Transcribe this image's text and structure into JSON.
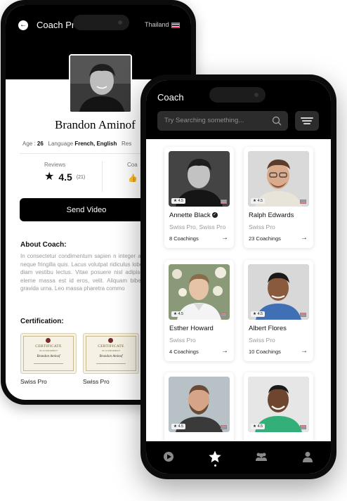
{
  "back": {
    "header_title": "Coach Pro",
    "country": "Thailand",
    "name": "Brandon Aminof",
    "age_label": "Age :",
    "age_value": "26",
    "language_label": "Language",
    "language_value": "French, English",
    "res_label": "Res",
    "reviews_label": "Reviews",
    "rating": "4.5",
    "rating_count": "(21)",
    "coach_label": "Coa",
    "send_button": "Send Video",
    "about_title": "About Coach:",
    "about_text": "In consectetur condimentum sapien n integer amet neque fringilla quis. Lacus volutpat ridiculus lobortis diam vestibu lectus. Vitae posuere nisl adipiscing eleme massa est id eros, velit. Aliquam bibendu gravida urna. Leo massa pharetra commo",
    "cert_title": "Certification:",
    "certs": [
      {
        "title": "CERTIFICATE",
        "subtitle": "OF ACHIEVEMENT",
        "signature": "Brandon Aminof",
        "label": "Swiss Pro"
      },
      {
        "title": "CERTIFICATE",
        "subtitle": "OF ACHIEVEMENT",
        "signature": "Brandon Aminof",
        "label": "Swiss Pro"
      }
    ]
  },
  "front": {
    "header_title": "Coach",
    "search_placeholder": "Try Searching something...",
    "coaches": [
      {
        "name": "Annette Black",
        "verified": true,
        "sub": "Swiss Pro,  Swiss Pro",
        "count": "8 Coachings",
        "rating": "4.5"
      },
      {
        "name": "Ralph Edwards",
        "verified": false,
        "sub": "Swiss Pro",
        "count": "23 Coachings",
        "rating": "4.5"
      },
      {
        "name": "Esther Howard",
        "verified": false,
        "sub": "Swiss Pro",
        "count": "4 Coachings",
        "rating": "4.5"
      },
      {
        "name": "Albert Flores",
        "verified": false,
        "sub": "Swiss Pro",
        "count": "10 Coachings",
        "rating": "4.5"
      },
      {
        "name": "",
        "verified": false,
        "sub": "",
        "count": "",
        "rating": "4.5"
      },
      {
        "name": "",
        "verified": false,
        "sub": "",
        "count": "",
        "rating": "4.5"
      }
    ],
    "tabs": [
      "play-icon",
      "star-icon",
      "group-icon",
      "profile-icon"
    ],
    "active_tab": "star-icon"
  },
  "colors": {
    "header_bg": "#000000",
    "search_bg": "#2c2c2c",
    "muted_text": "#9a9a9a"
  }
}
